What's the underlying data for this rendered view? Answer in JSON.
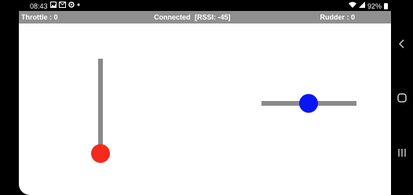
{
  "status_bar": {
    "time": "08:43",
    "icons_left": [
      "image-icon",
      "mail-icon",
      "settings-icon",
      "dot-icon"
    ],
    "battery": "92%",
    "icons_right": [
      "wifi-icon",
      "signal-icon",
      "battery-icon"
    ]
  },
  "header": {
    "throttle": "Throttle : 0",
    "connection": "Connected",
    "rssi": "[RSSI: -45]",
    "rudder": "Rudder : 0"
  },
  "controls": {
    "throttle": {
      "value": 0,
      "knob_color": "#f5291c"
    },
    "rudder": {
      "value": 0,
      "knob_color": "#0a16f2"
    },
    "track_color": "#8a8a8a"
  },
  "nav_bar": [
    "back-icon",
    "home-icon",
    "recents-icon"
  ]
}
